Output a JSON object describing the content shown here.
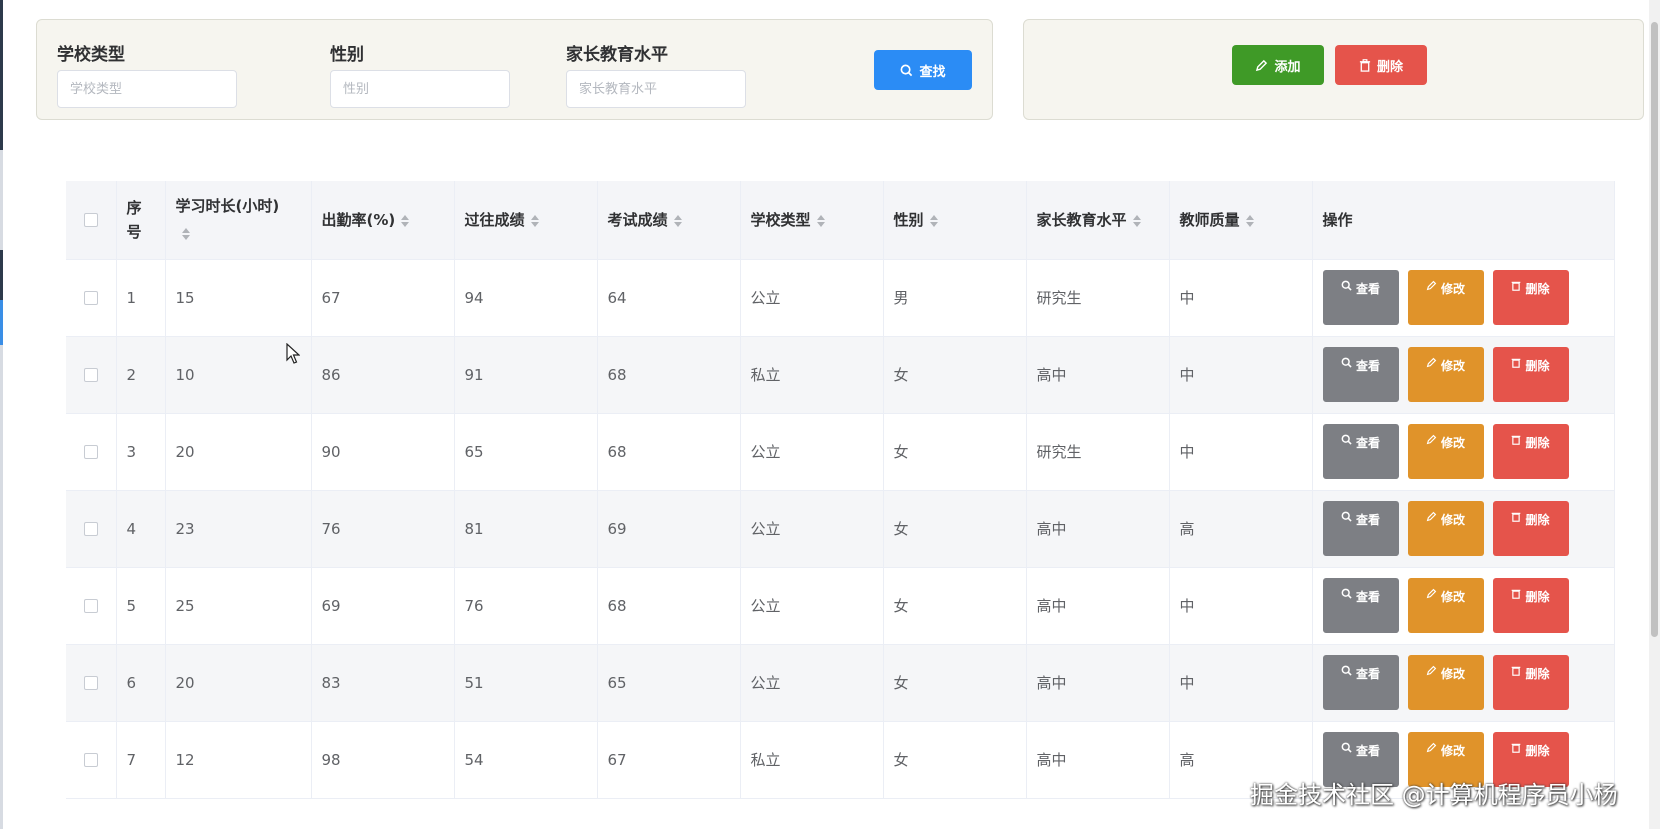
{
  "search": {
    "fields": [
      {
        "label": "学校类型",
        "placeholder": "学校类型",
        "value": ""
      },
      {
        "label": "性别",
        "placeholder": "性别",
        "value": ""
      },
      {
        "label": "家长教育水平",
        "placeholder": "家长教育水平",
        "value": ""
      }
    ],
    "search_button": "查找"
  },
  "actions": {
    "add_button": "添加",
    "delete_button": "删除"
  },
  "table": {
    "columns": [
      "序号",
      "学习时长(小时)",
      "出勤率(%)",
      "过往成绩",
      "考试成绩",
      "学校类型",
      "性别",
      "家长教育水平",
      "教师质量",
      "操作"
    ],
    "index_header": [
      "序",
      "号"
    ],
    "rows": [
      [
        "1",
        "15",
        "67",
        "94",
        "64",
        "公立",
        "男",
        "研究生",
        "中"
      ],
      [
        "2",
        "10",
        "86",
        "91",
        "68",
        "私立",
        "女",
        "高中",
        "中"
      ],
      [
        "3",
        "20",
        "90",
        "65",
        "68",
        "公立",
        "女",
        "研究生",
        "中"
      ],
      [
        "4",
        "23",
        "76",
        "81",
        "69",
        "公立",
        "女",
        "高中",
        "高"
      ],
      [
        "5",
        "25",
        "69",
        "76",
        "68",
        "公立",
        "女",
        "高中",
        "中"
      ],
      [
        "6",
        "20",
        "83",
        "51",
        "65",
        "公立",
        "女",
        "高中",
        "中"
      ],
      [
        "7",
        "12",
        "98",
        "54",
        "67",
        "私立",
        "女",
        "高中",
        "高"
      ]
    ],
    "row_actions": {
      "view": "查看",
      "edit": "修改",
      "delete": "删除"
    }
  },
  "watermark": "掘金技术社区 @计算机程序员小杨",
  "colors": {
    "primary": "#2b8cf5",
    "success": "#3f9a27",
    "danger": "#e5544b",
    "warning": "#e0932a",
    "info": "#7d7f84"
  }
}
